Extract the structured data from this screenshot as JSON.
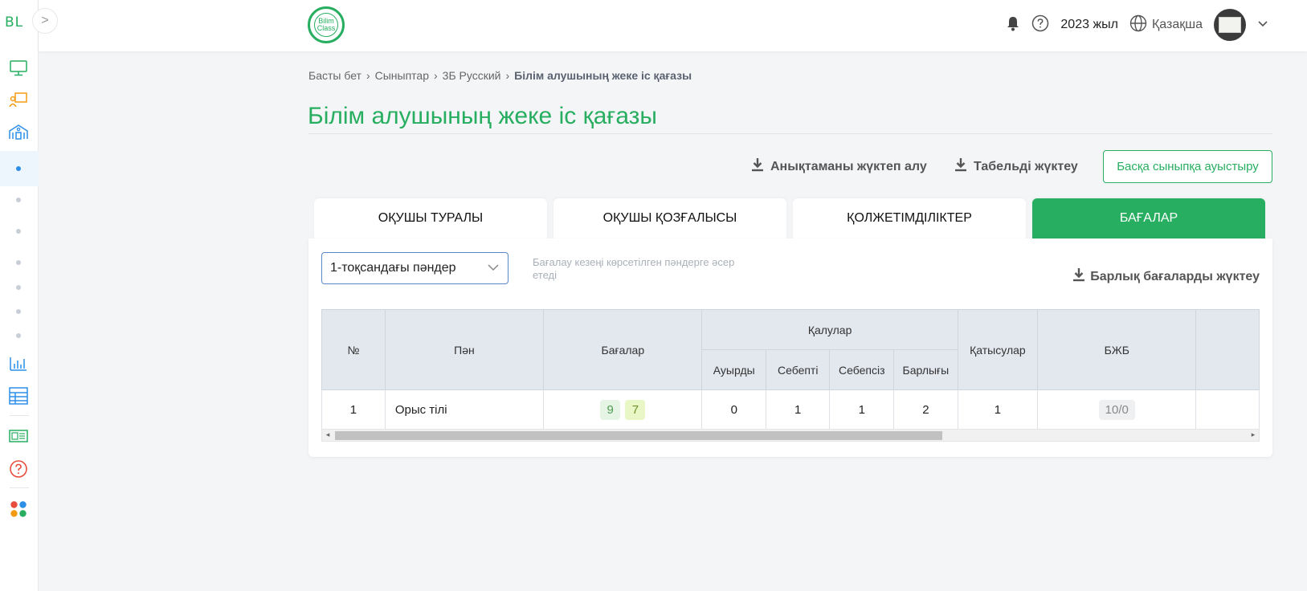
{
  "rail": {
    "logo": "BL",
    "toggle": ">"
  },
  "header": {
    "brand_line1": "Bilim",
    "brand_line2": "Class",
    "year": "2023 жыл",
    "language": "Қазақша"
  },
  "breadcrumb": {
    "items": [
      "Басты бет",
      "Сыныптар",
      "3Б Русский"
    ],
    "current": "Білім алушының жеке іс қағазы"
  },
  "page_title": "Білім алушының жеке іс қағазы",
  "actions": {
    "download_reference": "Анықтаманы жүктеп алу",
    "download_timesheet": "Табельді жүктеу",
    "switch_class": "Басқа сыныпқа ауыстыру"
  },
  "tabs": [
    {
      "label": "ОҚУШЫ ТУРАЛЫ",
      "active": false
    },
    {
      "label": "ОҚУШЫ ҚОЗҒАЛЫСЫ",
      "active": false
    },
    {
      "label": "ҚОЛЖЕТІМДІЛІКТЕР",
      "active": false
    },
    {
      "label": "БАҒАЛАР",
      "active": true
    }
  ],
  "filter": {
    "selected": "1-тоқсандағы пәндер",
    "hint": "Бағалау кезеңі көрсетілген пәндерге әсер етеді",
    "download_all": "Барлық бағаларды жүктеу"
  },
  "table": {
    "headers": {
      "num": "№",
      "subject": "Пән",
      "grades": "Бағалар",
      "absences": "Қалулар",
      "sick": "Ауырды",
      "excused": "Себепті",
      "unexcused": "Себепсіз",
      "total": "Барлығы",
      "attendance": "Қатысулар",
      "bjb": "БЖБ"
    },
    "rows": [
      {
        "num": "1",
        "subject": "Орыс тілі",
        "grade1": "9",
        "grade2": "7",
        "sick": "0",
        "excused": "1",
        "unexcused": "1",
        "total": "2",
        "attendance": "1",
        "bjb": "10/0"
      }
    ]
  },
  "colors": {
    "brand_green": "#27ae60",
    "grade_9_bg": "#e6f4e6",
    "grade_7_bg": "#e9f7c6"
  }
}
